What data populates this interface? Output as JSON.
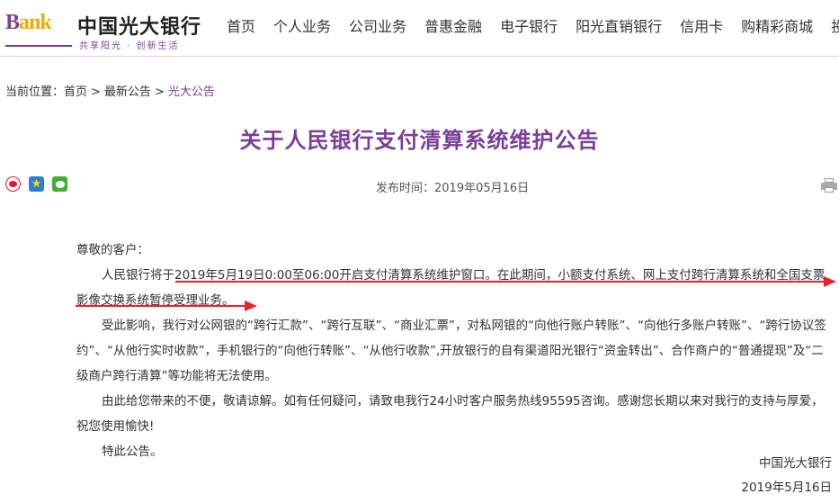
{
  "header": {
    "logo_en_b": "B",
    "logo_en_rest": "ank",
    "logo_cn": "中国光大银行",
    "slogan": "共享阳光 · 创新生活",
    "nav": [
      "首页",
      "个人业务",
      "公司业务",
      "普惠金融",
      "电子银行",
      "阳光直销银行",
      "信用卡",
      "购精彩商城",
      "投"
    ]
  },
  "breadcrumb": {
    "prefix": "当前位置：",
    "home": "首页",
    "section": "最新公告",
    "current": "光大公告",
    "separator": ">"
  },
  "article": {
    "title": "关于人民银行支付清算系统维护公告",
    "publish_time": "发布时间：2019年05月16日",
    "greeting": "尊敬的客户：",
    "paragraphs": [
      "人民银行将于2019年5月19日0:00至06:00开启支付清算系统维护窗口。在此期间，小额支付系统、网上支付跨行清算系统和全国支票影像交换系统暂停受理业务。",
      "受此影响，我行对公网银的“跨行汇款”、“跨行互联”、“商业汇票”，对私网银的“向他行账户转账”、“向他行多账户转账”、“跨行协议签约”、“从他行实时收款”，手机银行的“向他行转账”、“从他行收款”,开放银行的自有渠道阳光银行“资金转出”、合作商户的“普通提现”及“二级商户跨行清算”等功能将无法使用。",
      "由此给您带来的不便，敬请谅解。如有任何疑问，请致电我行24小时客户服务热线95595咨询。感谢您长期以来对我行的支持与厚爱，祝您使用愉快!",
      "特此公告。"
    ],
    "signature_org": "中国光大银行",
    "signature_date": "2019年5月16日"
  },
  "share": {
    "icons": [
      "weibo-icon",
      "qzone-icon",
      "wechat-icon"
    ]
  },
  "colors": {
    "brand_purple": "#7a3f98",
    "brand_gold": "#f2a900",
    "annotation_red": "#e2252b"
  }
}
